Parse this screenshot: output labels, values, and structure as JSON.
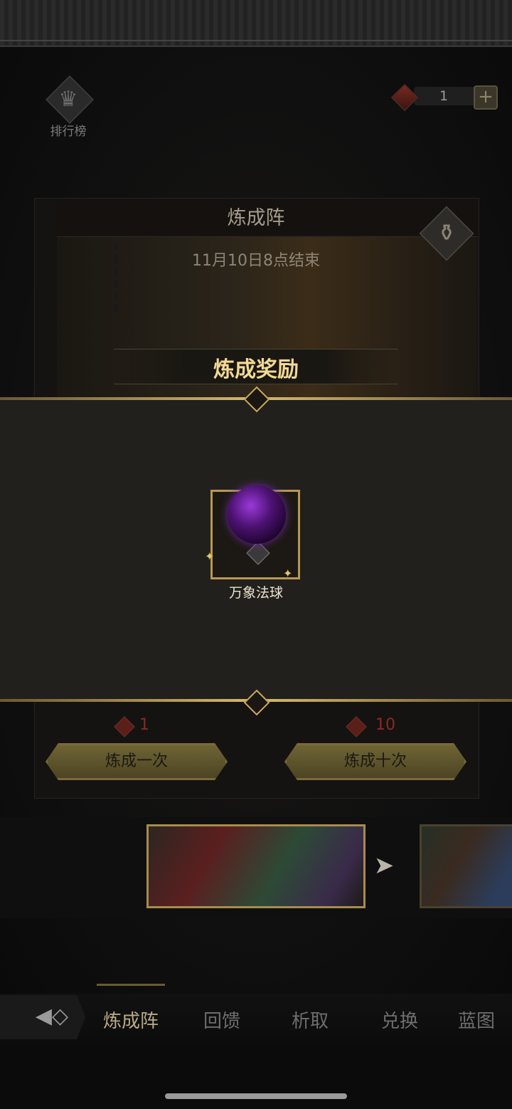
{
  "top": {
    "rank_label": "排行榜",
    "currency_value": "1",
    "currency_plus": "+"
  },
  "panel": {
    "title": "炼成阵",
    "end_time": "11月10日8点结束"
  },
  "reward": {
    "header": "炼成奖励",
    "item_name": "万象法球"
  },
  "actions": {
    "once_cost": "1",
    "once_label": "炼成一次",
    "ten_cost": "10",
    "ten_label": "炼成十次"
  },
  "carousel": {
    "next_arrow": "➤"
  },
  "nav": {
    "items": [
      "炼成阵",
      "回馈",
      "析取",
      "兑换",
      "蓝图"
    ]
  },
  "colors": {
    "accent_gold": "#d9b96a",
    "orb_purple": "#9a3ad8"
  }
}
